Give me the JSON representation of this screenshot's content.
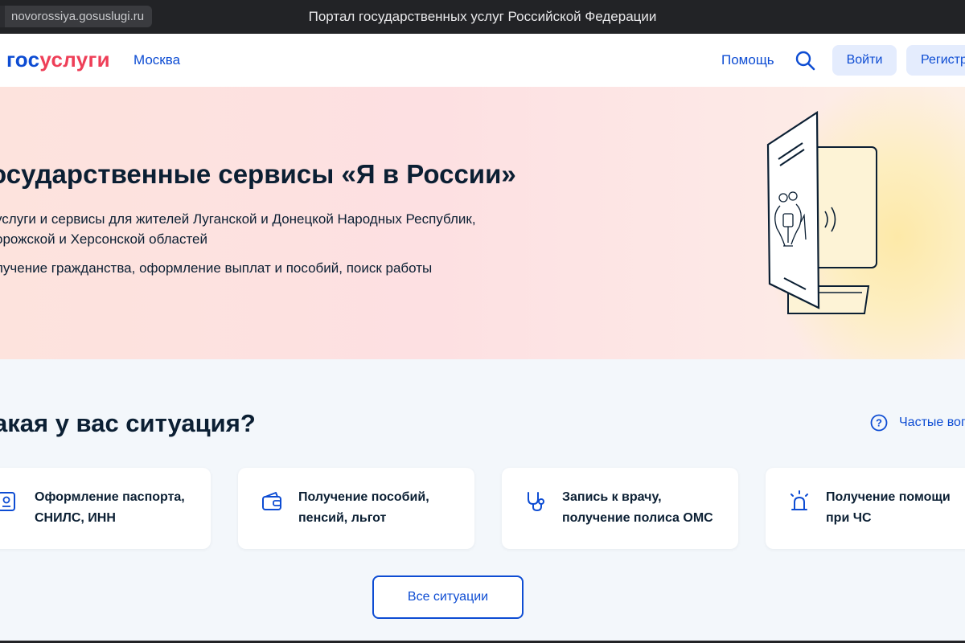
{
  "browser": {
    "url": "novorossiya.gosuslugi.ru",
    "window_title": "Портал государственных услуг Российской Федерации"
  },
  "header": {
    "logo_part1": "гос",
    "logo_part2": "услуги",
    "city": "Москва",
    "help": "Помощь",
    "search_icon": "search-icon",
    "login": "Войти",
    "register": "Регистрация"
  },
  "hero": {
    "title": "осударственные сервисы «Я в России»",
    "line1": "услуги и сервисы для жителей Луганской и Донецкой Народных Республик,",
    "line2": "орожской и Херсонской областей",
    "line3": "лучение гражданства, оформление выплат и пособий, поиск работы"
  },
  "situations": {
    "title": "акая у вас ситуация?",
    "faq": "Частые вопросы",
    "cards": [
      {
        "icon": "passport-icon",
        "line1": "Оформление паспорта,",
        "line2": "СНИЛС, ИНН"
      },
      {
        "icon": "wallet-icon",
        "line1": "Получение пособий,",
        "line2": "пенсий, льгот"
      },
      {
        "icon": "stethoscope-icon",
        "line1": "Запись к врачу,",
        "line2": "получение полиса ОМС"
      },
      {
        "icon": "alarm-light-icon",
        "line1": "Получение помощи",
        "line2": "при ЧС"
      }
    ],
    "all_button": "Все ситуации"
  },
  "colors": {
    "brand_blue": "#0d4cd3",
    "brand_red": "#ee3f58",
    "text_dark": "#0b1f33",
    "button_bg": "#e4ecfd"
  }
}
